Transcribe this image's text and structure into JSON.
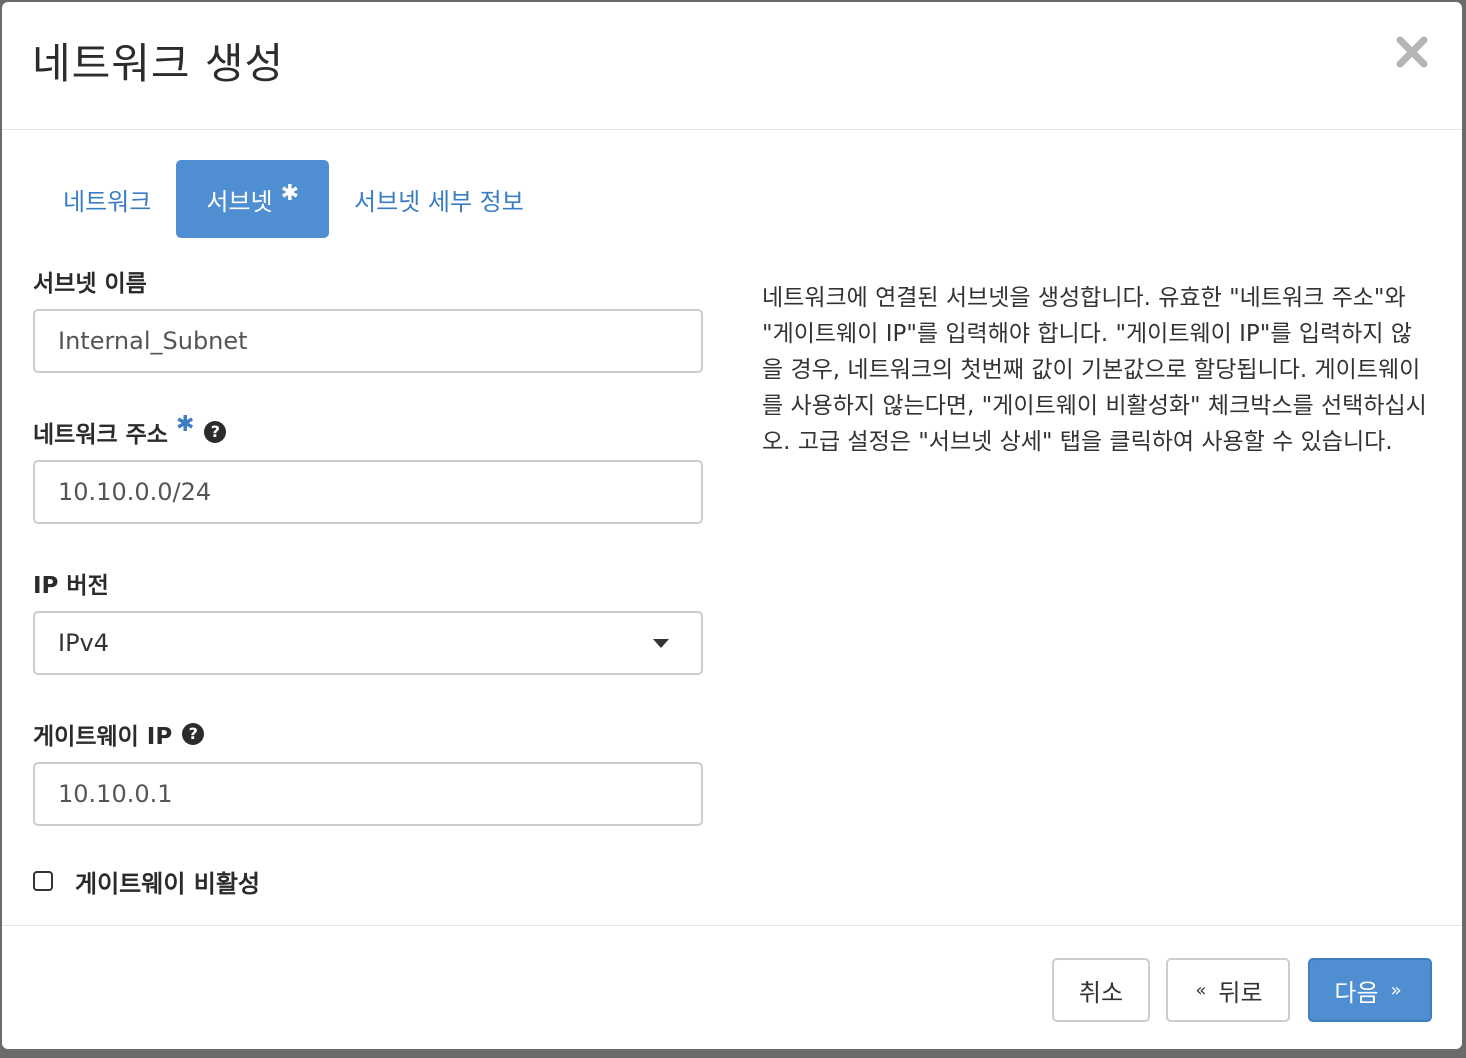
{
  "modal": {
    "title": "네트워크 생성"
  },
  "tabs": [
    {
      "label": "네트워크",
      "active": false
    },
    {
      "label": "서브넷",
      "active": true,
      "required_mark": "✱"
    },
    {
      "label": "서브넷 세부 정보",
      "active": false
    }
  ],
  "form": {
    "subnet_name": {
      "label": "서브넷 이름",
      "value": "Internal_Subnet"
    },
    "network_address": {
      "label": "네트워크 주소",
      "required_mark": "✱",
      "help": "?",
      "value": "10.10.0.0/24"
    },
    "ip_version": {
      "label": "IP 버전",
      "selected": "IPv4"
    },
    "gateway_ip": {
      "label": "게이트웨이 IP",
      "help": "?",
      "value": "10.10.0.1"
    },
    "disable_gateway": {
      "label": "게이트웨이 비활성",
      "checked": false
    }
  },
  "help_text": "네트워크에 연결된 서브넷을 생성합니다. 유효한 \"네트워크 주소\"와 \"게이트웨이 IP\"를 입력해야 합니다. \"게이트웨이 IP\"를 입력하지 않을 경우, 네트워크의 첫번째 값이 기본값으로 할당됩니다. 게이트웨이를 사용하지 않는다면, \"게이트웨이 비활성화\" 체크박스를 선택하십시오. 고급 설정은 \"서브넷 상세\" 탭을 클릭하여 사용할 수 있습니다.",
  "footer": {
    "cancel_label": "취소",
    "back_label": "뒤로",
    "back_arrow": "«",
    "next_label": "다음",
    "next_arrow": "»"
  },
  "colors": {
    "primary": "#4f8fd1",
    "link": "#3a7dc4"
  }
}
